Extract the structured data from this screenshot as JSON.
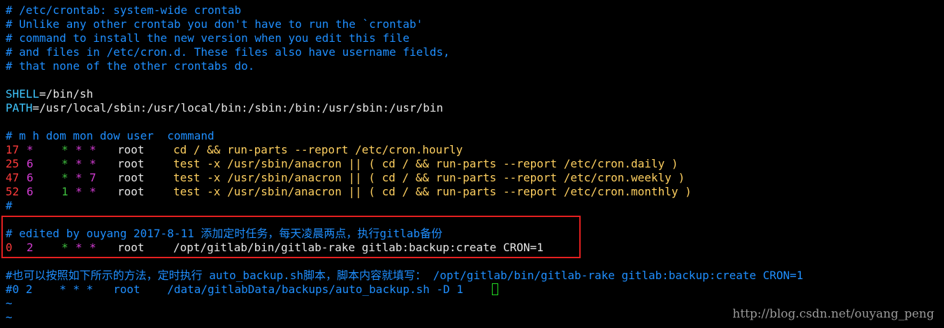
{
  "header_comments": [
    "# /etc/crontab: system-wide crontab",
    "# Unlike any other crontab you don't have to run the `crontab'",
    "# command to install the new version when you edit this file",
    "# and files in /etc/cron.d. These files also have username fields,",
    "# that none of the other crontabs do."
  ],
  "env": {
    "shell_key": "SHELL",
    "shell_value": "=/bin/sh",
    "path_key": "PATH",
    "path_value": "=/usr/local/sbin:/usr/local/bin:/sbin:/bin:/usr/sbin:/usr/bin"
  },
  "column_header": "# m h dom mon dow user  command",
  "cron_rows": [
    {
      "m": "17",
      "h": "*",
      "dom": "*",
      "mon": "*",
      "dow": "*",
      "user": "root",
      "command": "cd / && run-parts --report /etc/cron.hourly"
    },
    {
      "m": "25",
      "h": "6",
      "dom": "*",
      "mon": "*",
      "dow": "*",
      "user": "root",
      "command": "test -x /usr/sbin/anacron || ( cd / && run-parts --report /etc/cron.daily )"
    },
    {
      "m": "47",
      "h": "6",
      "dom": "*",
      "mon": "*",
      "dow": "7",
      "user": "root",
      "command": "test -x /usr/sbin/anacron || ( cd / && run-parts --report /etc/cron.weekly )"
    },
    {
      "m": "52",
      "h": "6",
      "dom": "1",
      "mon": "*",
      "dow": "*",
      "user": "root",
      "command": "test -x /usr/sbin/anacron || ( cd / && run-parts --report /etc/cron.monthly )"
    }
  ],
  "trailing_hash": "#",
  "highlighted": {
    "comment": "# edited by ouyang 2017-8-11 添加定时任务，每天凌晨两点，执行gitlab备份",
    "row": {
      "m": "0",
      "h": "2",
      "dom": "*",
      "mon": "*",
      "dow": "*",
      "user": "root",
      "command": "/opt/gitlab/bin/gitlab-rake gitlab:backup:create CRON=1"
    }
  },
  "footer_comments": [
    "#也可以按照如下所示的方法，定时执行 auto_backup.sh脚本，脚本内容就填写： /opt/gitlab/bin/gitlab-rake gitlab:backup:create CRON=1",
    "#0 2    * * *   root    /data/gitlabData/backups/auto_backup.sh -D 1"
  ],
  "tilde_lines": [
    "~",
    "~"
  ],
  "watermark": "http://blog.csdn.net/ouyang_peng",
  "colors": {
    "background": "#000000",
    "comment": "#1f8fff",
    "highlight_border": "#e62020",
    "cursor": "#24e224"
  }
}
